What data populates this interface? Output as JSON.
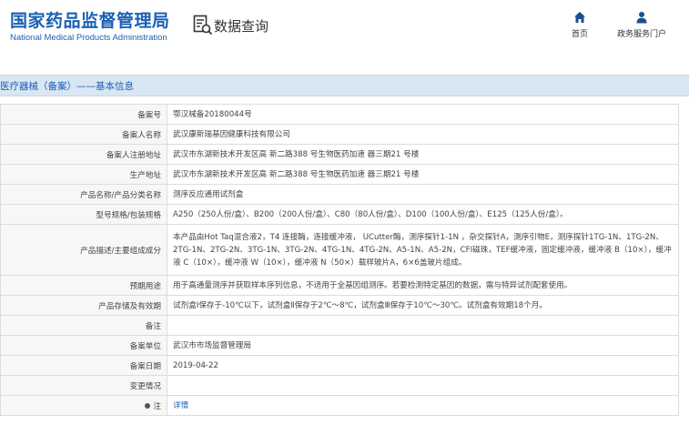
{
  "header": {
    "logo_cn": "国家药品监督管理局",
    "logo_en": "National Medical Products Administration",
    "query_title": "数据查询",
    "nav": [
      {
        "label": "首页",
        "icon": "home-icon"
      },
      {
        "label": "政务服务门户",
        "icon": "user-icon"
      }
    ]
  },
  "breadcrumb": "医疗器械（备案）——基本信息",
  "colors": {
    "brand": "#1a5fb4",
    "crumb_bg": "#d9e6f3",
    "label_bg": "#f7f7f7"
  },
  "rows": [
    {
      "label": "备案号",
      "value": "鄂汉械备20180044号"
    },
    {
      "label": "备案人名称",
      "value": "武汉康新瑞基因健康科技有限公司"
    },
    {
      "label": "备案人注册地址",
      "value": "武汉市东湖新技术开发区高 新二路388 号生物医药加速 器三期21 号楼"
    },
    {
      "label": "生产地址",
      "value": "武汉市东湖新技术开发区高 新二路388 号生物医药加速 器三期21 号楼"
    },
    {
      "label": "产品名称/产品分类名称",
      "value": "测序反应通用试剂盒"
    },
    {
      "label": "型号规格/包装规格",
      "value": "A250（250人份/盒）、B200（200人份/盒）、C80（80人份/盒）、D100（100人份/盒）、E125（125人份/盒）。"
    },
    {
      "label": "产品描述/主要组成成分",
      "value": "本产品由Hot Taq混合液2，T4 连接酶，连接缓冲液， UCutter酶，测序探针1-1N ，杂交探针A，测序引物E，测序探针1TG-1N、1TG-2N、2TG-1N、2TG-2N、3TG-1N、3TG-2N、4TG-1N、4TG-2N、A5-1N、A5-2N，CFI磁珠，TEF缓冲液，固定缓冲液，缓冲液 B（10×），缓冲液 C（10×），缓冲液 W（10×），缓冲液 N（50×）载样玻片A，6×6盖玻片组成。"
    },
    {
      "label": "预期用途",
      "value": "用于高通量测序并获取样本序列信息，不适用于全基因组测序。若要检测特定基因的数据，需与特异试剂配套使用。"
    },
    {
      "label": "产品存储及有效期",
      "value": "试剂盒Ⅰ保存于-10℃以下，试剂盒Ⅱ保存于2℃～8℃，试剂盒Ⅲ保存于10℃～30℃。试剂盒有效期18个月。"
    },
    {
      "label": "备注",
      "value": ""
    },
    {
      "label": "备案单位",
      "value": "武汉市市场监督管理局"
    },
    {
      "label": "备案日期",
      "value": "2019-04-22"
    },
    {
      "label": "变更情况",
      "value": ""
    },
    {
      "label": "注",
      "value": "详情"
    }
  ]
}
